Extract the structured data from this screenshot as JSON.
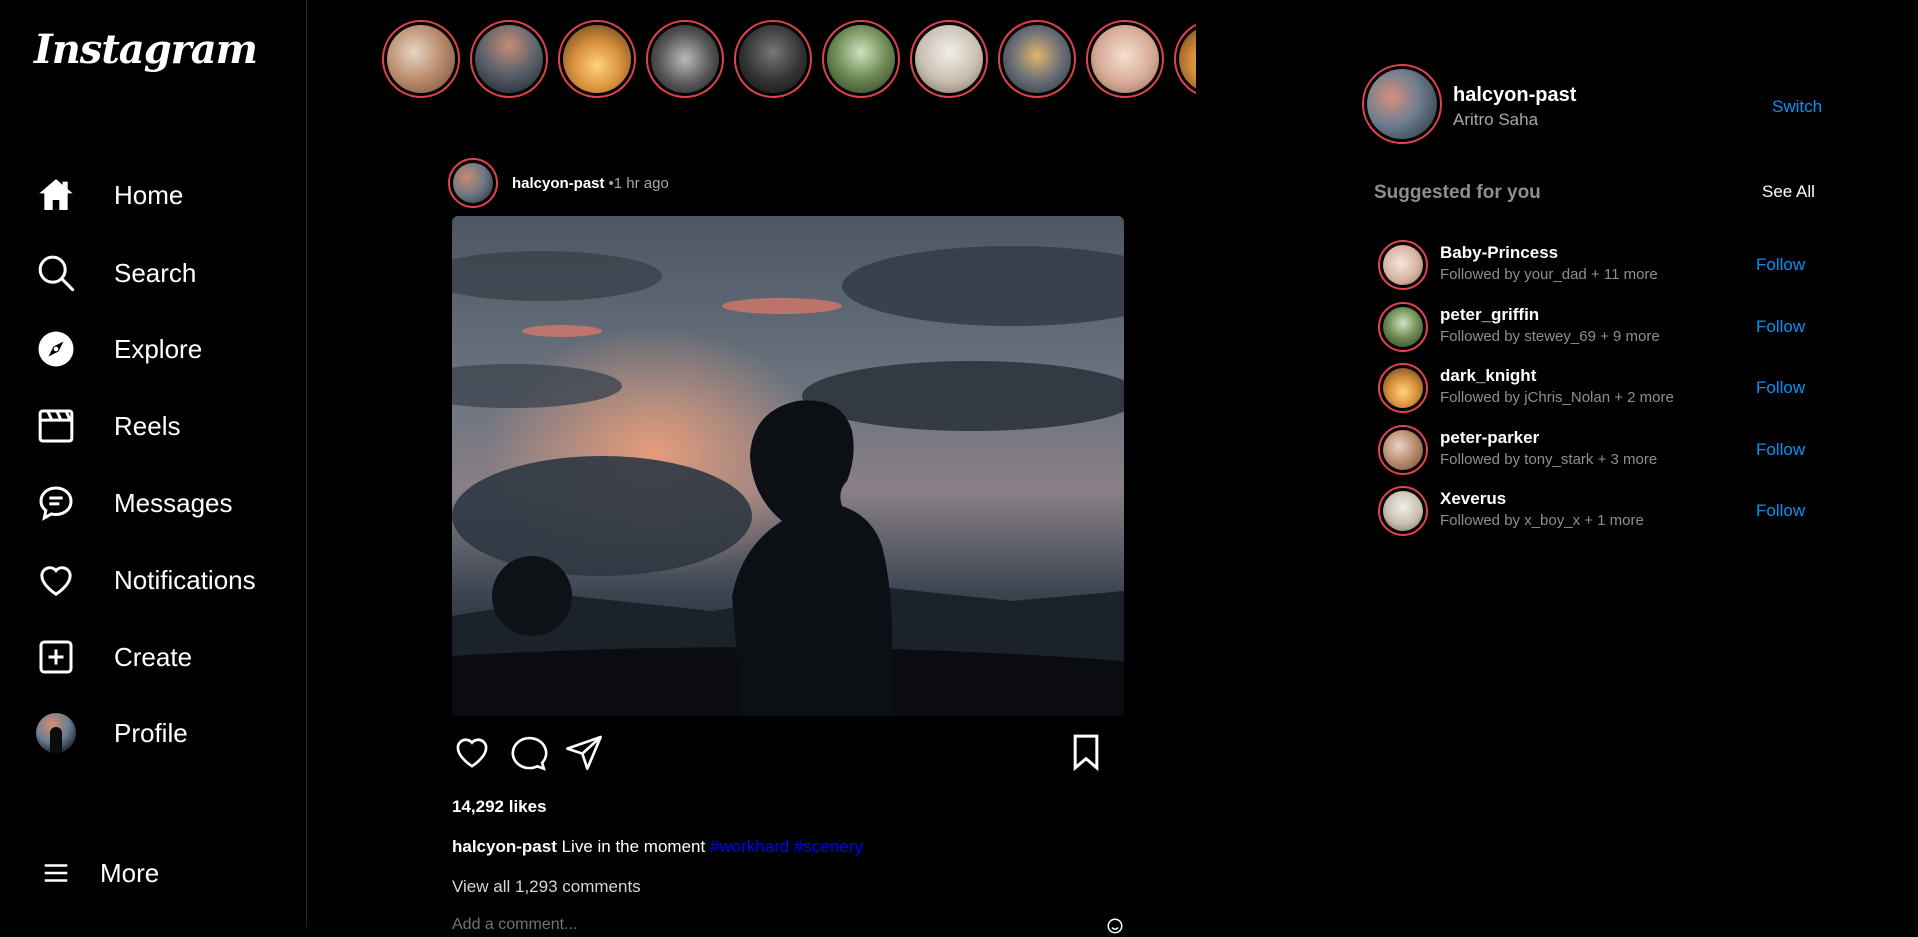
{
  "app": {
    "logo": "Instagram"
  },
  "nav": {
    "items": [
      {
        "label": "Home",
        "icon": "home-icon"
      },
      {
        "label": "Search",
        "icon": "search-icon"
      },
      {
        "label": "Explore",
        "icon": "compass-icon"
      },
      {
        "label": "Reels",
        "icon": "reels-icon"
      },
      {
        "label": "Messages",
        "icon": "message-icon"
      },
      {
        "label": "Notifications",
        "icon": "heart-icon"
      },
      {
        "label": "Create",
        "icon": "plus-square-icon"
      },
      {
        "label": "Profile",
        "icon": "avatar"
      }
    ],
    "more_label": "More"
  },
  "stories": {
    "count": 10,
    "ring_color": "#e2434b"
  },
  "post": {
    "username": "halcyon-past",
    "time": "•1 hr ago",
    "likes": "14,292 likes",
    "caption_user": "halcyon-past",
    "caption_text": " Live in the moment ",
    "tags": [
      "#workhard",
      "#scenery"
    ],
    "view_comments": "View all 1,293 comments",
    "comment_placeholder": "Add a comment..."
  },
  "me": {
    "username": "halcyon-past",
    "name": "Aritro Saha",
    "switch_label": "Switch"
  },
  "suggestions": {
    "title": "Suggested for you",
    "see_all": "See All",
    "follow_label": "Follow",
    "items": [
      {
        "username": "Baby-Princess",
        "sub": "Followed by your_dad + 11 more"
      },
      {
        "username": "peter_griffin",
        "sub": "Followed by stewey_69 + 9 more"
      },
      {
        "username": "dark_knight",
        "sub": "Followed by jChris_Nolan + 2 more"
      },
      {
        "username": "peter-parker",
        "sub": "Followed by tony_stark + 3 more"
      },
      {
        "username": "Xeverus",
        "sub": "Followed by x_boy_x + 1 more"
      }
    ]
  },
  "colors": {
    "accent": "#0095f6",
    "story_ring": "#e2434b",
    "tag": "#0000ff",
    "bg": "#000000"
  }
}
